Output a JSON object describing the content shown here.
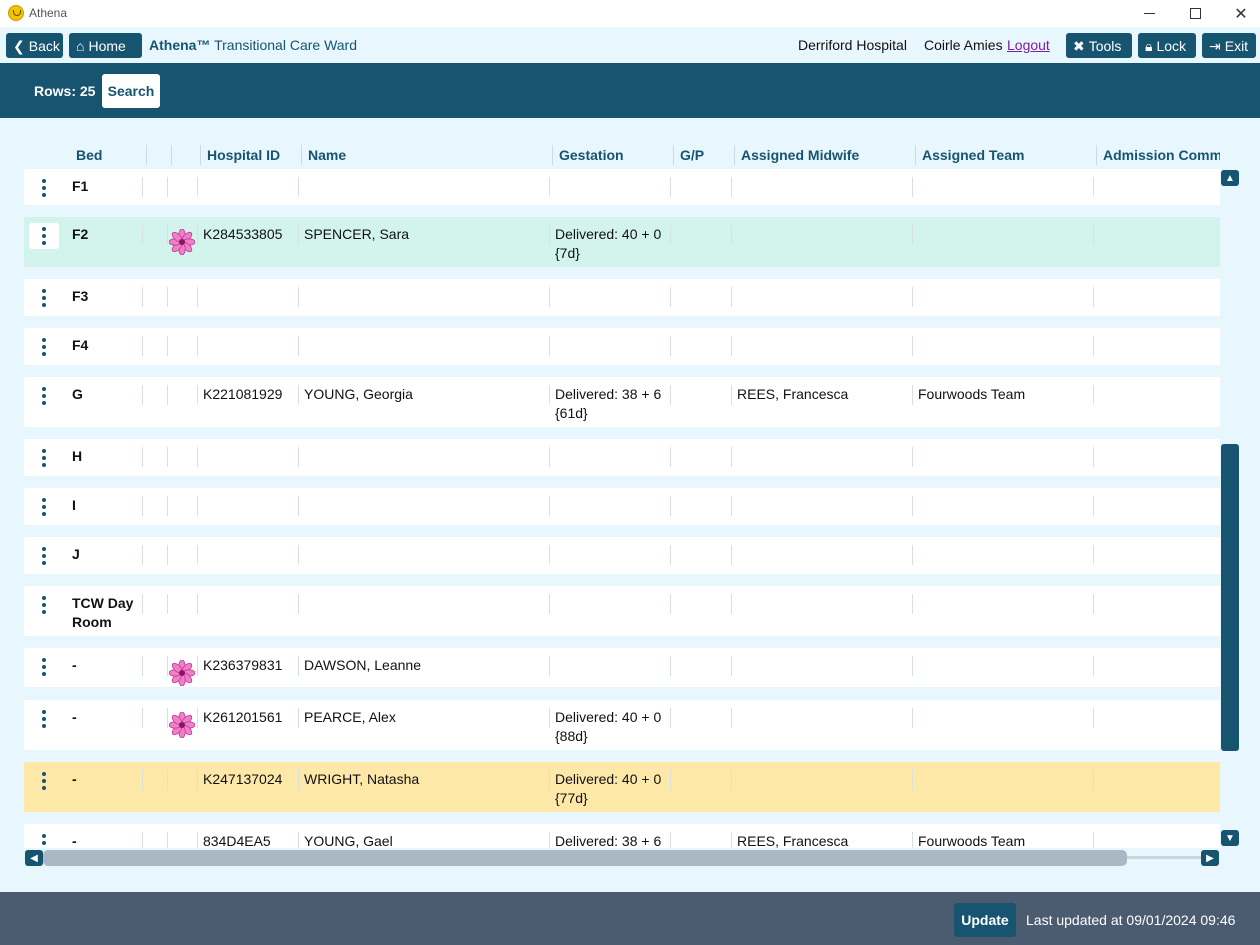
{
  "window": {
    "title": "Athena"
  },
  "nav": {
    "back_label": "Back",
    "home_label": "Home",
    "brand": "Athena™",
    "ward": "Transitional Care Ward",
    "hospital": "Derriford Hospital",
    "user": "Coirle Amies",
    "logout_label": "Logout",
    "tools_label": "Tools",
    "lock_label": "Lock",
    "exit_label": "Exit"
  },
  "search": {
    "rows_label": "Rows: 25",
    "search_label": "Search"
  },
  "columns": [
    "Bed",
    "",
    "",
    "Hospital ID",
    "Name",
    "Gestation",
    "G/P",
    "Assigned Midwife",
    "Assigned Team",
    "Admission Comm"
  ],
  "rows": [
    {
      "bed": "F1",
      "flower": false,
      "id": "",
      "name": "",
      "gest1": "",
      "gest2": "",
      "midwife": "",
      "team": "",
      "style": "white"
    },
    {
      "bed": "F2",
      "flower": true,
      "id": "K284533805",
      "name": "SPENCER, Sara",
      "gest1": "Delivered: 40 + 0",
      "gest2": "{7d}",
      "midwife": "",
      "team": "",
      "style": "green"
    },
    {
      "bed": "F3",
      "flower": false,
      "id": "",
      "name": "",
      "gest1": "",
      "gest2": "",
      "midwife": "",
      "team": "",
      "style": "white"
    },
    {
      "bed": "F4",
      "flower": false,
      "id": "",
      "name": "",
      "gest1": "",
      "gest2": "",
      "midwife": "",
      "team": "",
      "style": "white"
    },
    {
      "bed": "G",
      "flower": false,
      "id": "K221081929",
      "name": "YOUNG, Georgia",
      "gest1": "Delivered: 38 + 6",
      "gest2": "{61d}",
      "midwife": "REES, Francesca",
      "team": "Fourwoods Team",
      "style": "white"
    },
    {
      "bed": "H",
      "flower": false,
      "id": "",
      "name": "",
      "gest1": "",
      "gest2": "",
      "midwife": "",
      "team": "",
      "style": "white"
    },
    {
      "bed": "I",
      "flower": false,
      "id": "",
      "name": "",
      "gest1": "",
      "gest2": "",
      "midwife": "",
      "team": "",
      "style": "white"
    },
    {
      "bed": "J",
      "flower": false,
      "id": "",
      "name": "",
      "gest1": "",
      "gest2": "",
      "midwife": "",
      "team": "",
      "style": "white"
    },
    {
      "bed": "TCW Day Room",
      "flower": false,
      "id": "",
      "name": "",
      "gest1": "",
      "gest2": "",
      "midwife": "",
      "team": "",
      "style": "white"
    },
    {
      "bed": "-",
      "flower": true,
      "id": "K236379831",
      "name": "DAWSON, Leanne",
      "gest1": "",
      "gest2": "",
      "midwife": "",
      "team": "",
      "style": "white"
    },
    {
      "bed": "-",
      "flower": true,
      "id": "K261201561",
      "name": "PEARCE, Alex",
      "gest1": "Delivered: 40 + 0",
      "gest2": "{88d}",
      "midwife": "",
      "team": "",
      "style": "white"
    },
    {
      "bed": "-",
      "flower": false,
      "id": "K247137024",
      "name": "WRIGHT, Natasha",
      "gest1": "Delivered: 40 + 0",
      "gest2": "{77d}",
      "midwife": "",
      "team": "",
      "style": "yellow"
    },
    {
      "bed": "-",
      "flower": false,
      "id": "834D4EA5",
      "name": "YOUNG, Gael",
      "gest1": "Delivered: 38 + 6",
      "gest2": "",
      "midwife": "REES, Francesca",
      "team": "Fourwoods Team",
      "style": "white"
    }
  ],
  "footer": {
    "update_label": "Update",
    "last_updated": "Last updated at 09/01/2024 09:46"
  },
  "colors": {
    "primary": "#16546f",
    "green_row": "#d3f4ec",
    "yellow_row": "#fde8a8",
    "footer": "#4b5b70"
  }
}
